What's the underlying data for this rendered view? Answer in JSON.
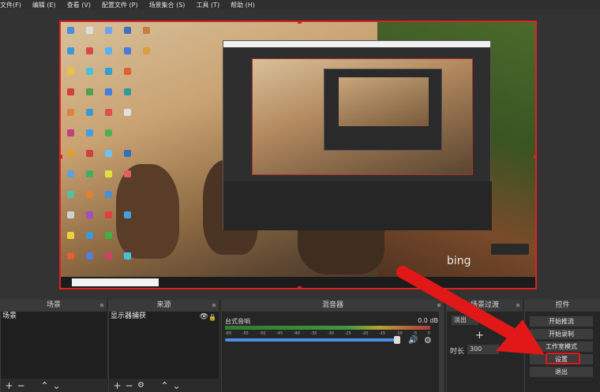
{
  "menu": [
    "文件(F)",
    "编辑 (E)",
    "查看 (V)",
    "配置文件 (P)",
    "场景集合 (S)",
    "工具 (T)",
    "帮助 (H)"
  ],
  "preview": {
    "nested_watermark": "bing",
    "taskbar_search": "在这里输入你要搜索的内容"
  },
  "docks": {
    "scenes": {
      "title": "场景",
      "items": [
        "场景"
      ]
    },
    "sources": {
      "title": "来源",
      "items": [
        "显示器捕获"
      ]
    },
    "mixer": {
      "title": "混音器",
      "track_name": "台式音响",
      "track_value": "0.0 dB",
      "ticks": [
        "-60",
        "-55",
        "-50",
        "-45",
        "-40",
        "-35",
        "-30",
        "-25",
        "-20",
        "-15",
        "-10",
        "-5",
        "0"
      ]
    },
    "transitions": {
      "title": "场景过渡",
      "selected": "淡出",
      "duration_label": "时长",
      "duration_value": "300"
    },
    "controls": {
      "title": "控件",
      "buttons": [
        "开始推流",
        "开始录制",
        "工作室模式",
        "设置",
        "退出"
      ]
    }
  },
  "annotation_color": "#e01818"
}
